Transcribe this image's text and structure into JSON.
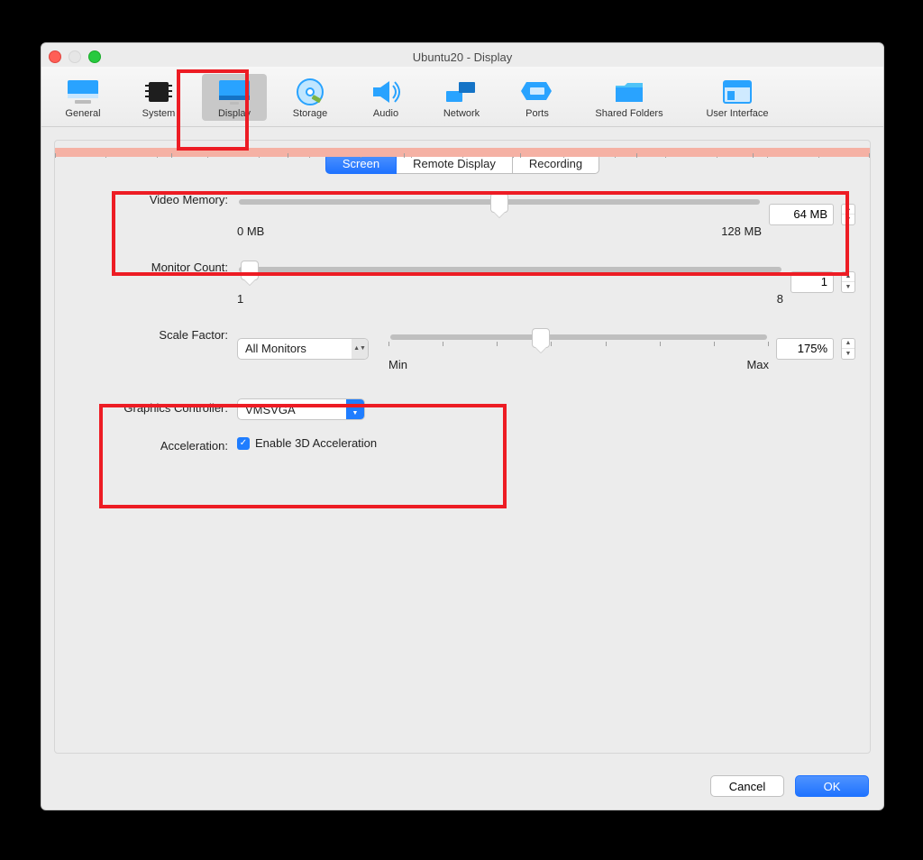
{
  "window": {
    "title": "Ubuntu20 - Display"
  },
  "toolbar": {
    "items": [
      {
        "label": "General"
      },
      {
        "label": "System"
      },
      {
        "label": "Display"
      },
      {
        "label": "Storage"
      },
      {
        "label": "Audio"
      },
      {
        "label": "Network"
      },
      {
        "label": "Ports"
      },
      {
        "label": "Shared Folders"
      },
      {
        "label": "User Interface"
      }
    ],
    "active_index": 2
  },
  "tabs": {
    "items": [
      "Screen",
      "Remote Display",
      "Recording"
    ],
    "active_index": 0
  },
  "video_memory": {
    "label": "Video Memory:",
    "min_label": "0 MB",
    "max_label": "128 MB",
    "value": "64 MB",
    "value_num": 64,
    "max_num": 128
  },
  "monitor_count": {
    "label": "Monitor Count:",
    "min_label": "1",
    "max_label": "8",
    "value": "1",
    "value_num": 1,
    "max_num": 8
  },
  "scale_factor": {
    "label": "Scale Factor:",
    "selector": "All Monitors",
    "min_label": "Min",
    "max_label": "Max",
    "value": "175%"
  },
  "graphics_controller": {
    "label": "Graphics Controller:",
    "value": "VMSVGA"
  },
  "acceleration": {
    "label": "Acceleration:",
    "checkbox_label": "Enable 3D Acceleration",
    "checked": true
  },
  "footer": {
    "cancel": "Cancel",
    "ok": "OK"
  }
}
